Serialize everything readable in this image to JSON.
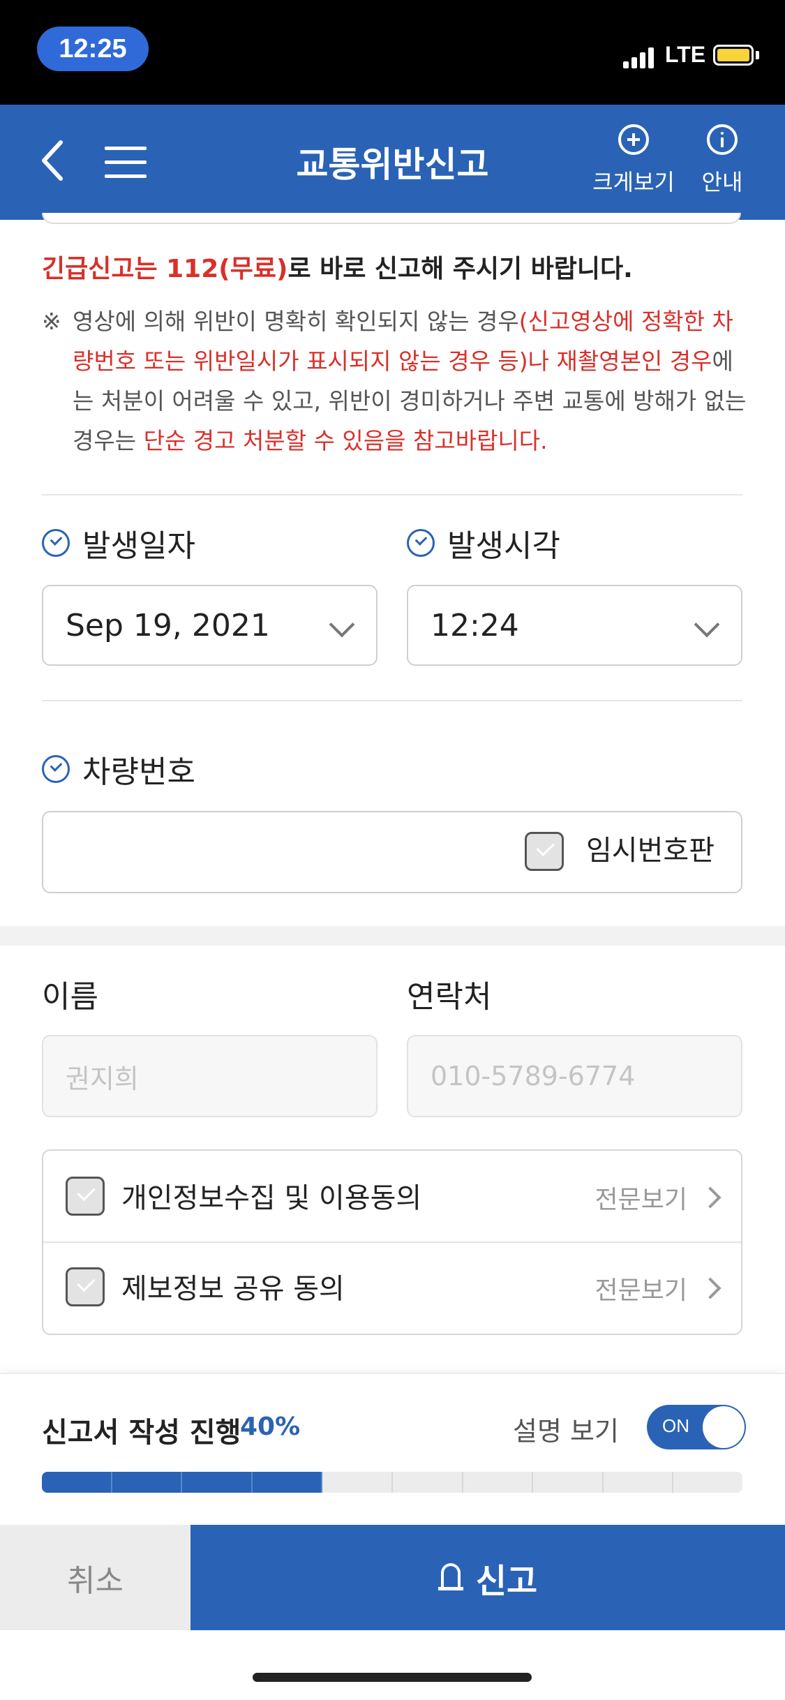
{
  "status_bar": {
    "time": "12:25",
    "network": "LTE",
    "battery_color": "#f6d43a"
  },
  "nav": {
    "title": "교통위반신고",
    "zoom_label": "크게보기",
    "info_label": "안내",
    "icons": [
      "back-icon",
      "menu-icon",
      "plus-circle-icon",
      "info-icon"
    ],
    "color": "#2a63b5"
  },
  "notice": {
    "urgent_red": "긴급신고는 112(무료)",
    "urgent_rest": "로 바로 신고해 주시기 바랍니다.",
    "mark": "※",
    "part1": "영상에 의해 위반이 명확히 확인되지 않는 경우",
    "part2_red": "(신고영상에 정확한 차량번호 또는 위반일시가 표시되지 않는 경우 등)나 재촬영본인 경우",
    "part3": "에는 처분이 어려울 수 있고, 위반이 경미하거나 주변 교통에 방해가 없는 경우는 ",
    "part4_red": "단순 경고 처분할 수 있음을 참고바랍니다."
  },
  "form": {
    "date_label": "발생일자",
    "date_value": "Sep 19, 2021",
    "time_label": "발생시각",
    "time_value": "12:24",
    "plate_label": "차량번호",
    "plate_value": "",
    "temp_plate_label": "임시번호판",
    "temp_plate_checked": false
  },
  "reporter": {
    "name_label": "이름",
    "name_value": "권지희",
    "contact_label": "연락처",
    "contact_value": "010-5789-6774"
  },
  "consents": [
    {
      "label": "개인정보수집 및 이용동의",
      "link": "전문보기",
      "checked": false
    },
    {
      "label": "제보정보 공유 동의",
      "link": "전문보기",
      "checked": false
    }
  ],
  "progress": {
    "label": "신고서 작성 진행",
    "percent_text": "40%",
    "percent": 40,
    "explain_label": "설명 보기",
    "toggle_text": "ON",
    "toggle_on": true
  },
  "actions": {
    "cancel": "취소",
    "report": "신고"
  }
}
